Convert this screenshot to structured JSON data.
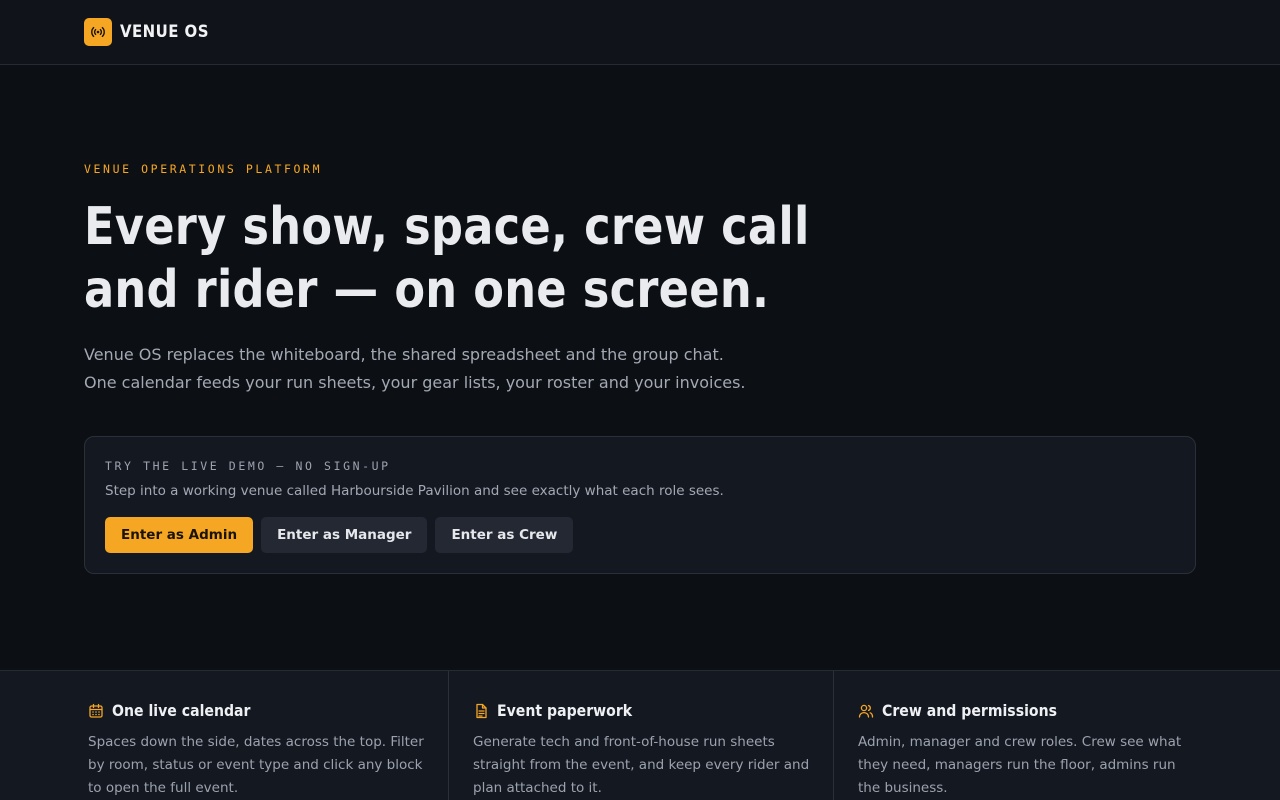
{
  "brand": {
    "name": "VENUE OS",
    "icon": "broadcast-icon",
    "accent": "#f5a623"
  },
  "hero": {
    "eyebrow": "VENUE OPERATIONS PLATFORM",
    "headline": "Every show, space, crew call and rider — on one screen.",
    "sub_line1": "Venue OS replaces the whiteboard, the shared spreadsheet and the group chat.",
    "sub_line2": "One calendar feeds your run sheets, your gear lists, your roster and your invoices."
  },
  "demo": {
    "eyebrow": "TRY THE LIVE DEMO — NO SIGN-UP",
    "description": "Step into a working venue called Harbourside Pavilion and see exactly what each role sees.",
    "buttons": {
      "admin": "Enter as Admin",
      "manager": "Enter as Manager",
      "crew": "Enter as Crew"
    }
  },
  "features": [
    {
      "icon": "calendar-icon",
      "title": "One live calendar",
      "description": "Spaces down the side, dates across the top. Filter by room, status or event type and click any block to open the full event."
    },
    {
      "icon": "document-icon",
      "title": "Event paperwork",
      "description": "Generate tech and front-of-house run sheets straight from the event, and keep every rider and plan attached to it."
    },
    {
      "icon": "users-icon",
      "title": "Crew and permissions",
      "description": "Admin, manager and crew roles. Crew see what they need, managers run the floor, admins run the business."
    }
  ]
}
